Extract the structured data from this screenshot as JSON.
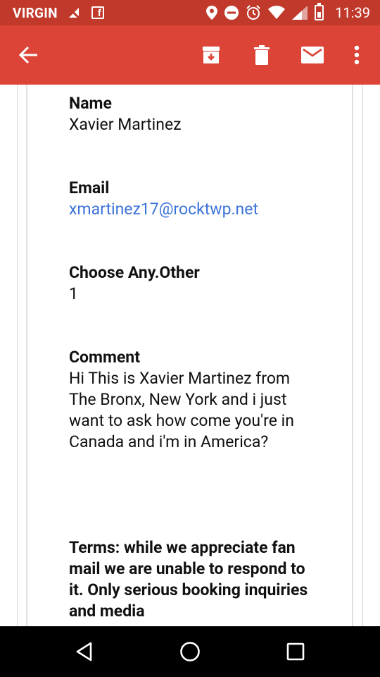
{
  "status_bar": {
    "carrier": "VIRGIN",
    "time": "11:39",
    "icons": [
      "signal-off-icon",
      "facebook-icon",
      "location-icon",
      "do-not-disturb-icon",
      "alarm-icon",
      "wifi-icon",
      "cell-signal-icon",
      "battery-charging-icon"
    ]
  },
  "app_bar": {
    "color": "#db4437",
    "actions": [
      "back-arrow-icon",
      "archive-icon",
      "delete-icon",
      "mark-unread-icon",
      "more-vert-icon"
    ]
  },
  "email_body": {
    "fields": [
      {
        "label": "Name",
        "value": "Xavier Martinez"
      },
      {
        "label": "Email",
        "value": "xmartinez17@rocktwp.net"
      },
      {
        "label": "Choose Any.Other",
        "value": "1"
      },
      {
        "label": "Comment",
        "value": "Hi This is Xavier Martinez from The Bronx, New York and i just want to ask how come you're in Canada and i'm in America?"
      }
    ],
    "terms": "Terms: while we appreciate fan mail we are unable to respond to it. Only serious booking inquiries and media"
  },
  "nav_bar": {
    "buttons": [
      "back-triangle-icon",
      "home-circle-icon",
      "recents-square-icon"
    ]
  }
}
